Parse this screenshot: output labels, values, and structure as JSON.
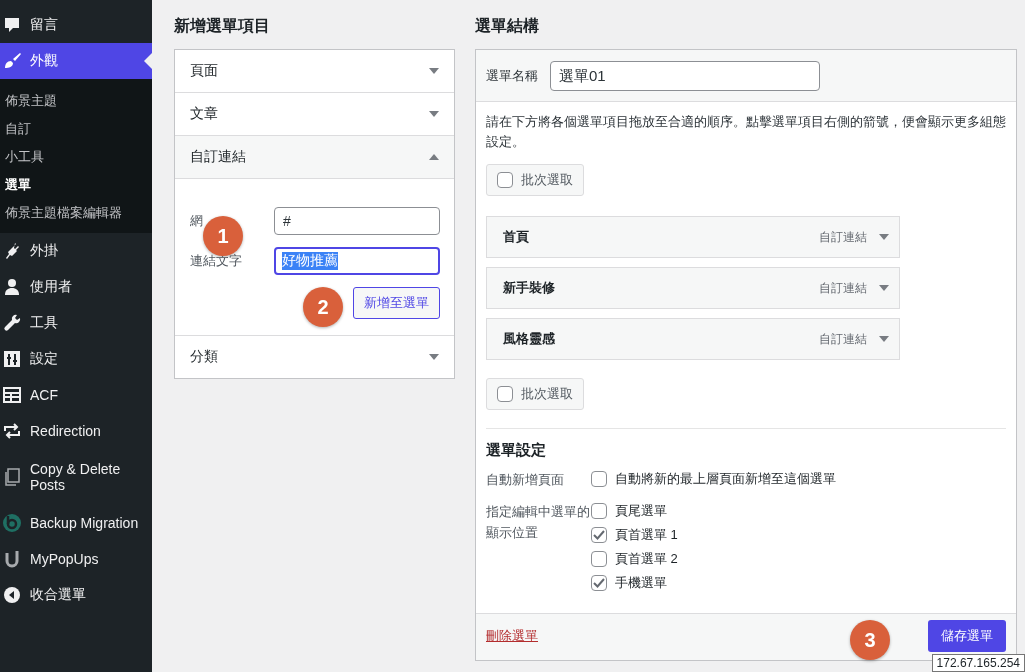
{
  "sidebar": {
    "items": [
      {
        "label": "留言",
        "selected": false
      },
      {
        "label": "外觀",
        "selected": true,
        "children": [
          {
            "label": "佈景主題",
            "selected": false
          },
          {
            "label": "自訂",
            "selected": false
          },
          {
            "label": "小工具",
            "selected": false
          },
          {
            "label": "選單",
            "selected": true
          },
          {
            "label": "佈景主題檔案編輯器",
            "selected": false
          }
        ]
      },
      {
        "label": "外掛",
        "selected": false
      },
      {
        "label": "使用者",
        "selected": false
      },
      {
        "label": "工具",
        "selected": false
      },
      {
        "label": "設定",
        "selected": false
      },
      {
        "label": "ACF",
        "selected": false
      },
      {
        "label": "Redirection",
        "selected": false
      },
      {
        "label": "Copy & Delete Posts",
        "selected": false
      },
      {
        "label": "Backup Migration",
        "selected": false
      },
      {
        "label": "MyPopUps",
        "selected": false
      },
      {
        "label": "收合選單",
        "selected": false
      }
    ]
  },
  "add_items": {
    "title": "新增選單項目",
    "sections": [
      {
        "title": "頁面",
        "expanded": false
      },
      {
        "title": "文章",
        "expanded": false
      },
      {
        "title": "自訂連結",
        "expanded": true,
        "fields": [
          {
            "label": "網",
            "value": "#",
            "focused": false
          },
          {
            "label": "連結文字",
            "value": "好物推薦",
            "focused": true
          }
        ],
        "button": "新增至選單"
      },
      {
        "title": "分類",
        "expanded": false
      }
    ]
  },
  "structure": {
    "title": "選單結構",
    "name_label": "選單名稱",
    "name_value": "選單01",
    "instructions": "請在下方將各個選單項目拖放至合適的順序。點擊選單項目右側的箭號，便會顯示更多組態設定。",
    "bulk_top": {
      "label": "批次選取",
      "checked": false
    },
    "items": [
      {
        "title": "首頁",
        "type": "自訂連結"
      },
      {
        "title": "新手裝修",
        "type": "自訂連結"
      },
      {
        "title": "風格靈感",
        "type": "自訂連結"
      }
    ],
    "bulk_bottom": {
      "label": "批次選取",
      "checked": false
    },
    "settings": {
      "title": "選單設定",
      "groups": [
        {
          "label": "自動新增頁面",
          "options": [
            {
              "label": "自動將新的最上層頁面新增至這個選單",
              "checked": false
            }
          ]
        },
        {
          "label": "指定編輯中選單的顯示位置",
          "options": [
            {
              "label": "頁尾選單",
              "checked": false
            },
            {
              "label": "頁首選單 1",
              "checked": true
            },
            {
              "label": "頁首選單 2",
              "checked": false
            },
            {
              "label": "手機選單",
              "checked": true
            }
          ]
        }
      ]
    },
    "delete_link": "刪除選單",
    "save_button": "儲存選單"
  },
  "annotations": [
    "1",
    "2",
    "3"
  ],
  "tooltip": "172.67.165.254"
}
